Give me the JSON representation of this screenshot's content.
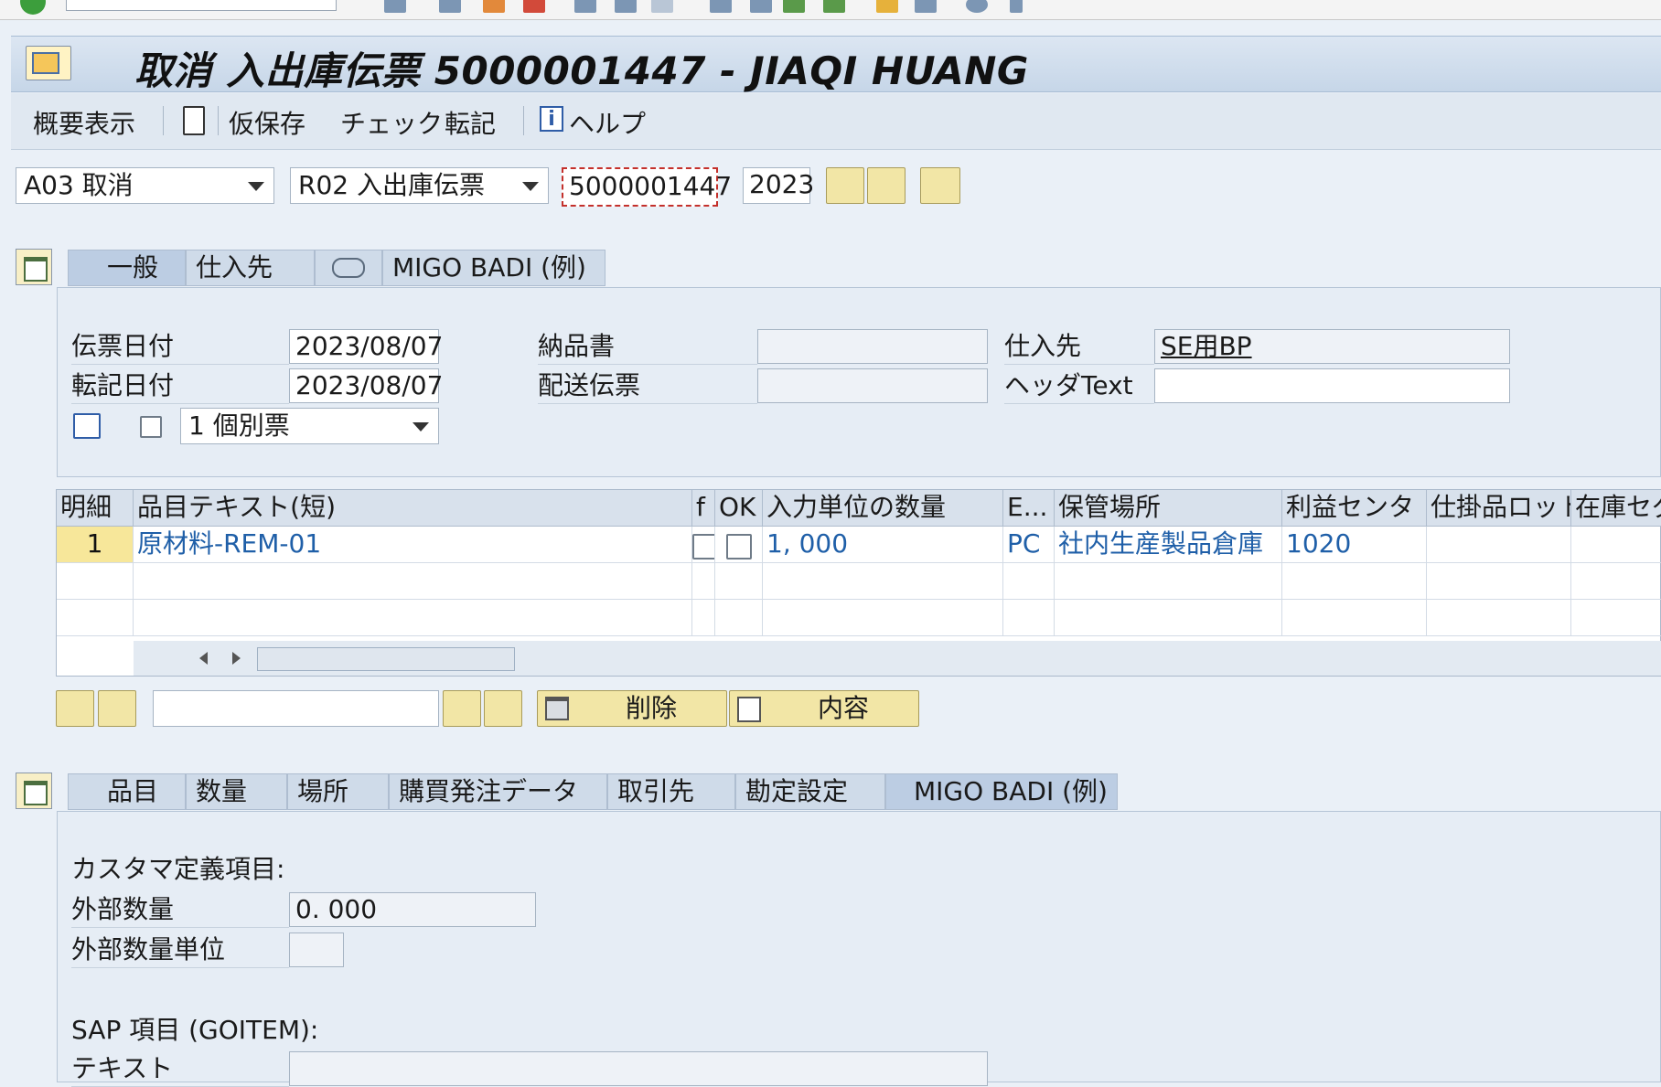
{
  "window": {
    "title": "取消 入出庫伝票 5000001447 - JIAQI HUANG"
  },
  "appbar": {
    "overview": "概要表示",
    "hold": "仮保存",
    "check": "チェック",
    "post": "転記",
    "help": "ヘルプ"
  },
  "selection": {
    "action": "A03 取消",
    "reference": "R02 入出庫伝票",
    "doc_number": "5000001447",
    "year": "2023"
  },
  "header_tabs": [
    "一般",
    "仕入先",
    "",
    "MIGO BADI (例)"
  ],
  "header": {
    "doc_date_label": "伝票日付",
    "doc_date": "2023/08/07",
    "post_date_label": "転記日付",
    "post_date": "2023/08/07",
    "print_option": "1 個別票",
    "delivery_note_label": "納品書",
    "delivery_note": "",
    "bill_of_lading_label": "配送伝票",
    "bill_of_lading": "",
    "vendor_label": "仕入先",
    "vendor": "SE用BP",
    "header_text_label": "ヘッダText",
    "header_text": ""
  },
  "table": {
    "columns": [
      "明細",
      "品目テキスト(短)",
      "f",
      "OK",
      "入力単位の数量",
      "E...",
      "保管場所",
      "利益センタ",
      "仕掛品ロット",
      "在庫セグ"
    ],
    "rows": [
      {
        "line": "1",
        "material_text": "原材料-REM-01",
        "qty": "1, 000",
        "unit": "PC",
        "storage": "社内生産製品倉庫",
        "profit_center": "1020"
      }
    ]
  },
  "item_buttons": {
    "delete": "削除",
    "contents": "内容"
  },
  "item_tabs": [
    "品目",
    "数量",
    "場所",
    "購買発注データ",
    "取引先",
    "勘定設定",
    "MIGO BADI (例)"
  ],
  "custom": {
    "heading": "カスタマ定義項目:",
    "ext_qty_label": "外部数量",
    "ext_qty": "0. 000",
    "ext_unit_label": "外部数量単位",
    "ext_unit": "",
    "sap_heading": "SAP 項目 (GOITEM):",
    "text_label": "テキスト",
    "text": ""
  }
}
